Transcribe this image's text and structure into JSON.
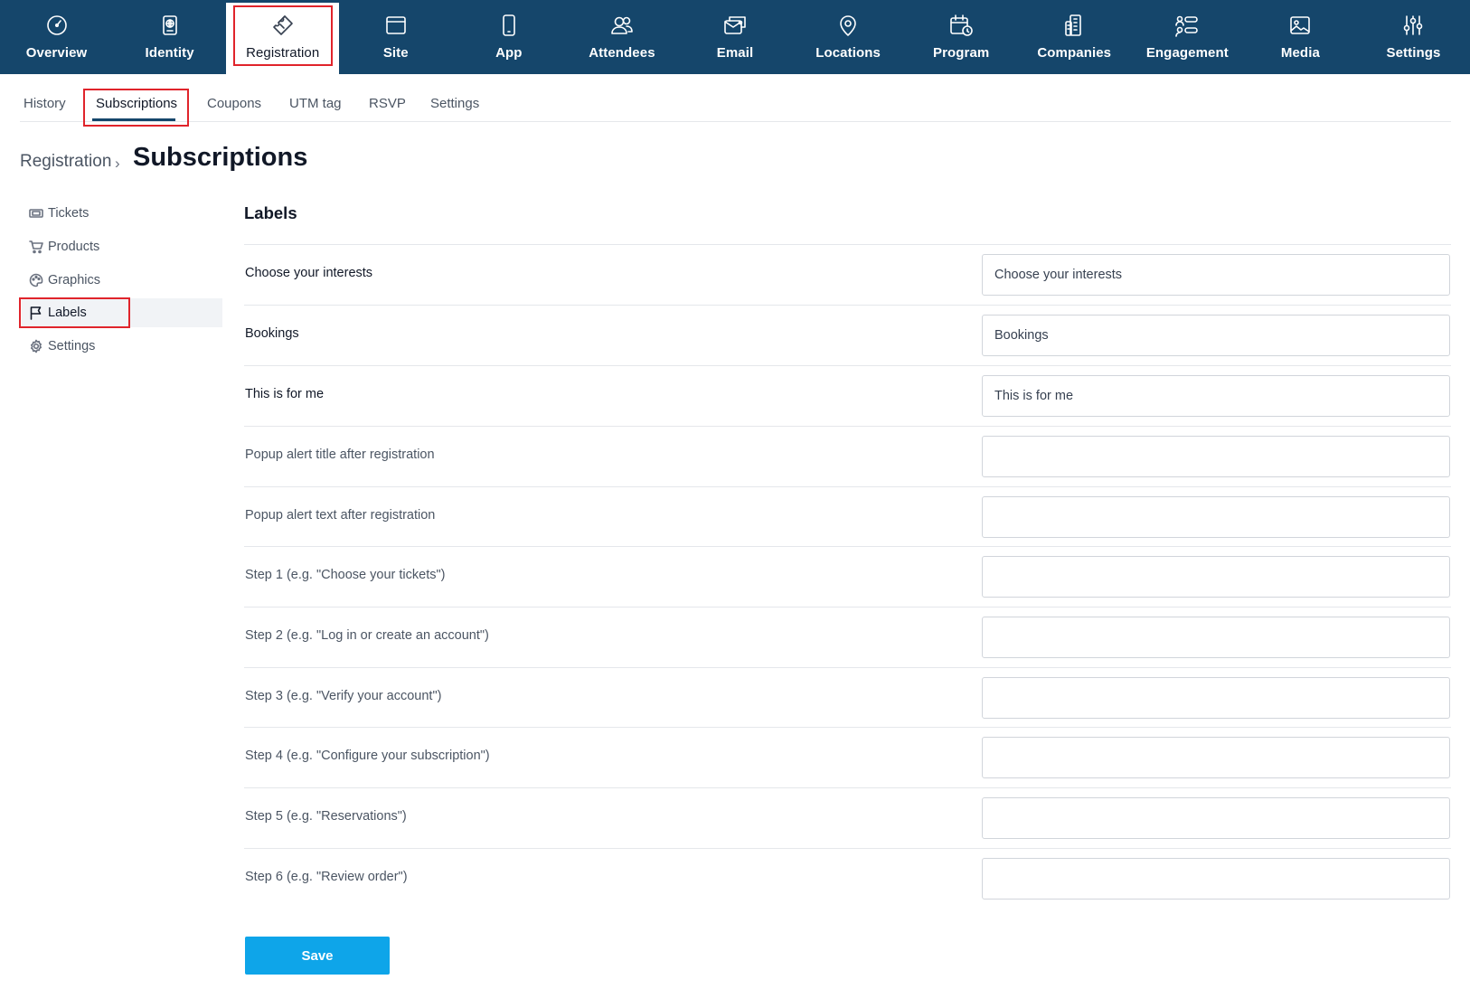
{
  "topnav": {
    "items": [
      {
        "label": "Overview"
      },
      {
        "label": "Identity"
      },
      {
        "label": "Registration"
      },
      {
        "label": "Site"
      },
      {
        "label": "App"
      },
      {
        "label": "Attendees"
      },
      {
        "label": "Email"
      },
      {
        "label": "Locations"
      },
      {
        "label": "Program"
      },
      {
        "label": "Companies"
      },
      {
        "label": "Engagement"
      },
      {
        "label": "Media"
      },
      {
        "label": "Settings"
      }
    ],
    "active": "Registration",
    "background_color": "#15466b"
  },
  "subtabs": {
    "items": [
      {
        "label": "History"
      },
      {
        "label": "Subscriptions"
      },
      {
        "label": "Coupons"
      },
      {
        "label": "UTM tag"
      },
      {
        "label": "RSVP"
      },
      {
        "label": "Settings"
      }
    ],
    "active": "Subscriptions"
  },
  "breadcrumb": {
    "parent": "Registration",
    "separator": "›"
  },
  "page_title": "Subscriptions",
  "sidemenu": {
    "items": [
      {
        "label": "Tickets",
        "icon": "ticket-icon"
      },
      {
        "label": "Products",
        "icon": "cart-icon"
      },
      {
        "label": "Graphics",
        "icon": "palette-icon"
      },
      {
        "label": "Labels",
        "icon": "flag-icon"
      },
      {
        "label": "Settings",
        "icon": "gear-icon"
      }
    ],
    "active": "Labels"
  },
  "labels_section": {
    "title": "Labels",
    "fields": [
      {
        "label": "Choose your interests",
        "value": "Choose your interests"
      },
      {
        "label": "Bookings",
        "value": "Bookings"
      },
      {
        "label": "This is for me",
        "value": "This is for me"
      },
      {
        "label": "Popup alert title after registration",
        "value": ""
      },
      {
        "label": "Popup alert text after registration",
        "value": ""
      },
      {
        "label": "Step 1 (e.g. \"Choose your tickets\")",
        "value": ""
      },
      {
        "label": "Step 2 (e.g. \"Log in or create an account\")",
        "value": ""
      },
      {
        "label": "Step 3 (e.g. \"Verify your account\")",
        "value": ""
      },
      {
        "label": "Step 4 (e.g. \"Configure your subscription\")",
        "value": ""
      },
      {
        "label": "Step 5 (e.g. \"Reservations\")",
        "value": ""
      },
      {
        "label": "Step 6 (e.g. \"Review order\")",
        "value": ""
      }
    ],
    "save_label": "Save",
    "save_color": "#0ea5e9"
  },
  "highlight_color": "#e0242b"
}
